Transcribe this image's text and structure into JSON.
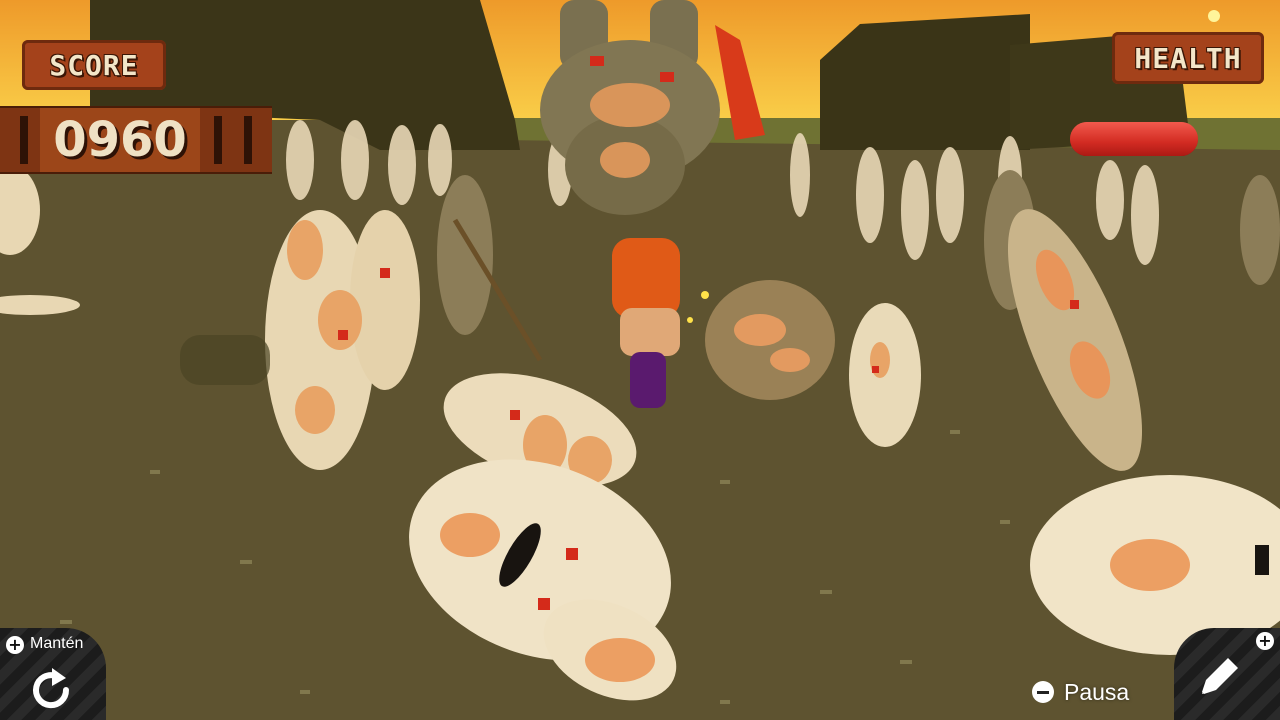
{
  "hud": {
    "score_label": "SCORE",
    "score_value": "0960",
    "health_label": "HEALTH",
    "health_fraction": 1.0
  },
  "controls": {
    "hold_label": "Mantén",
    "hold_icon": "retry-icon",
    "pause_label": "Pausa",
    "pause_icon": "minus-icon",
    "edit_icon": "pencil-icon"
  },
  "colors": {
    "sky_top": "#f0a32c",
    "sky_bottom": "#fbd24a",
    "ground": "#5e5330",
    "block": "#3b3518",
    "hud_plate": "#a4421b",
    "health": "#d22b22",
    "bunny_light": "#efe3c4",
    "bunny_spot": "#f0a46a",
    "bunny_dark": "#776b4a",
    "eye": "#d42a1a",
    "player_shirt": "#e05a17",
    "player_pants": "#5a1a6e"
  }
}
